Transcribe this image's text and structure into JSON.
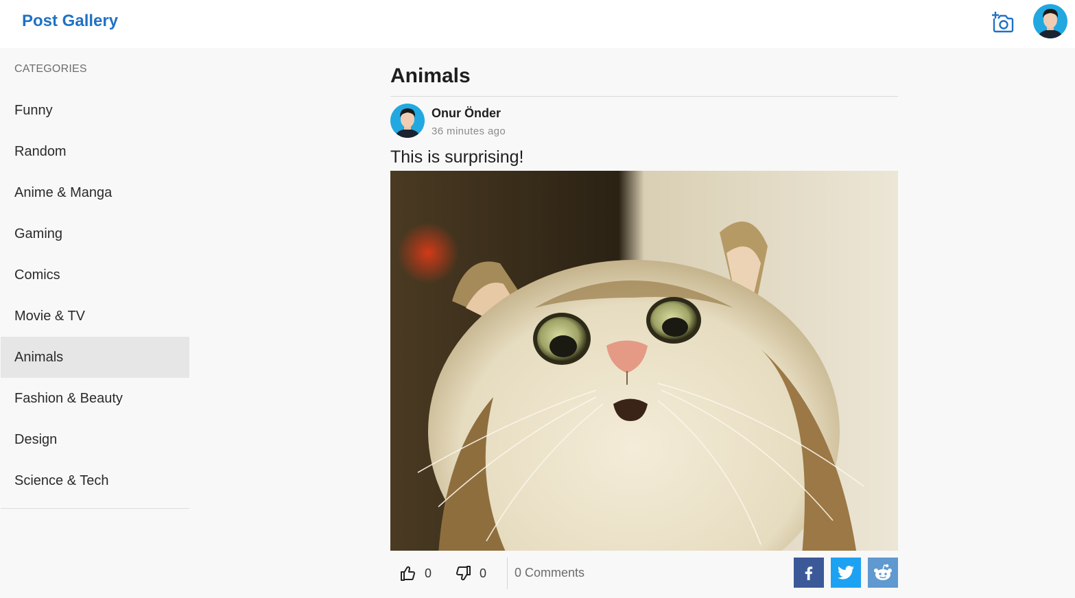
{
  "app": {
    "title": "Post Gallery"
  },
  "header": {
    "upload_icon": "add-photo-icon",
    "avatar_icon": "user-avatar"
  },
  "sidebar": {
    "heading": "CATEGORIES",
    "items": [
      {
        "label": "Funny"
      },
      {
        "label": "Random"
      },
      {
        "label": "Anime & Manga"
      },
      {
        "label": "Gaming"
      },
      {
        "label": "Comics"
      },
      {
        "label": "Movie & TV"
      },
      {
        "label": "Animals",
        "active": true
      },
      {
        "label": "Fashion & Beauty"
      },
      {
        "label": "Design"
      },
      {
        "label": "Science & Tech"
      }
    ]
  },
  "main": {
    "title": "Animals",
    "post": {
      "author": "Onur Önder",
      "time": "36 minutes ago",
      "title": "This is surprising!",
      "image_icon": "surprised-cat-photo",
      "likes": "0",
      "dislikes": "0",
      "comments": "0 Comments",
      "share": [
        {
          "network": "facebook",
          "icon": "facebook-icon",
          "color": "#3b5998"
        },
        {
          "network": "twitter",
          "icon": "twitter-icon",
          "color": "#1da1f2"
        },
        {
          "network": "reddit",
          "icon": "reddit-icon",
          "color": "#5f99cf"
        }
      ]
    }
  },
  "colors": {
    "brand": "#1f72c4",
    "sidebar_active": "#e6e6e6",
    "background": "#f8f8f8"
  }
}
